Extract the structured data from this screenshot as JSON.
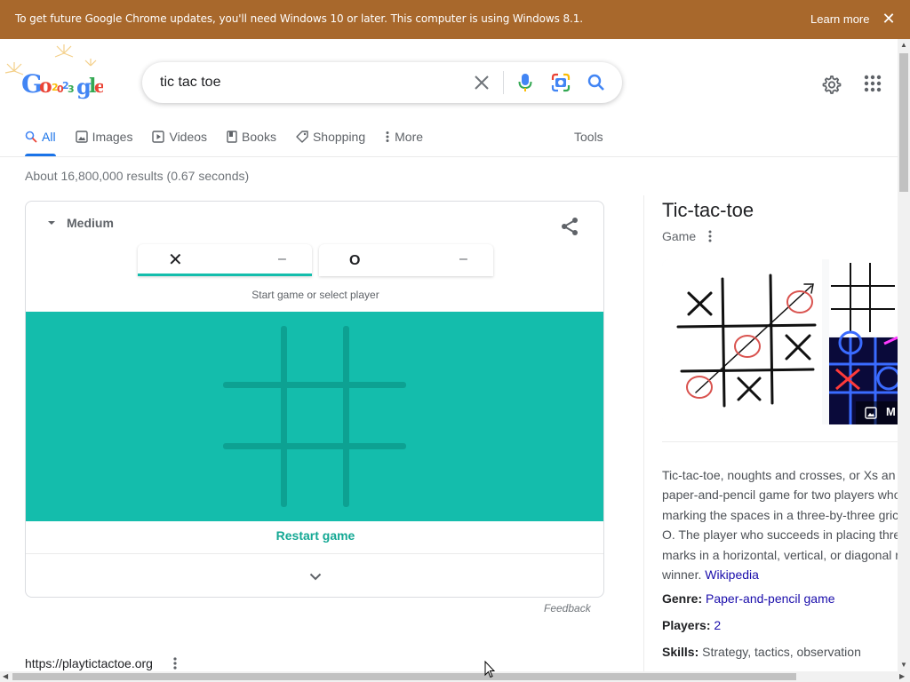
{
  "banner": {
    "message": "To get future Google Chrome updates, you'll need Windows 10 or later. This computer is using Windows 8.1.",
    "learn_more": "Learn more",
    "close": "✕"
  },
  "logo": {
    "text": "Google"
  },
  "search": {
    "query": "tic tac toe"
  },
  "tabs": [
    {
      "label": "All",
      "icon": "search-icon",
      "active": true
    },
    {
      "label": "Images",
      "icon": "image-icon"
    },
    {
      "label": "Videos",
      "icon": "play-icon"
    },
    {
      "label": "Books",
      "icon": "book-icon"
    },
    {
      "label": "Shopping",
      "icon": "tag-icon"
    },
    {
      "label": "More",
      "icon": "more-vertical-icon"
    }
  ],
  "tools_label": "Tools",
  "result_stats": "About 16,800,000 results (0.67 seconds)",
  "game": {
    "difficulty": "Medium",
    "player_x": {
      "symbol": "✕",
      "score": "–"
    },
    "player_o": {
      "symbol": "O",
      "score": "–"
    },
    "hint": "Start game or select player",
    "restart": "Restart game",
    "board_color": "#14bdac",
    "accent": "#14a894"
  },
  "feedback": "Feedback",
  "first_result_url": "https://playtictactoe.org",
  "knowledge_panel": {
    "title": "Tic-tac-toe",
    "subtitle": "Game",
    "images_more": "M",
    "description_lines": [
      "Tic-tac-toe, noughts and crosses, or Xs an",
      "paper-and-pencil game for two players who",
      "marking the spaces in a three-by-three gric",
      "O. The player who succeeds in placing thre",
      "marks in a horizontal, vertical, or diagonal r",
      "winner."
    ],
    "source_link": "Wikipedia",
    "facts": [
      {
        "label": "Genre:",
        "value": "Paper-and-pencil game",
        "link": true
      },
      {
        "label": "Players:",
        "value": "2",
        "link": true
      },
      {
        "label": "Skills:",
        "value": "Strategy, tactics, observation",
        "link": false
      }
    ]
  },
  "colors": {
    "banner": "#a8682c",
    "link": "#1a0dab",
    "tab_active": "#1a73e8"
  }
}
